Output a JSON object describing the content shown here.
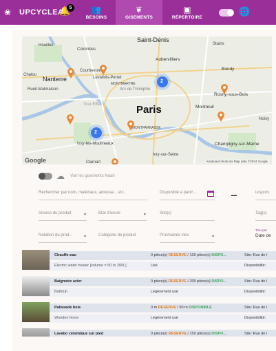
{
  "brand": {
    "name": "UPCYCLEA",
    "logo_icon": "upcyclea-logo-icon"
  },
  "notifications": {
    "count": "5",
    "icon": "bell-icon"
  },
  "nav": [
    {
      "label": "BESOINS",
      "icon": "needs-icon"
    },
    {
      "label": "GISEMENTS",
      "icon": "leaf-icon",
      "active": true
    },
    {
      "label": "RÉPERTOIRE",
      "icon": "directory-icon"
    }
  ],
  "header_right": {
    "toggle_icon": "theme-toggle",
    "globe_icon": "globe-icon"
  },
  "map": {
    "labels": {
      "houilles": "Houilles",
      "colombes": "Colombes",
      "saint_denis": "Saint-Denis",
      "stains": "Stains",
      "aubervilliers": "Aubervilliers",
      "chatou": "Chatou",
      "courbevoie": "Courbevoie",
      "levallois": "Levallois-Perret",
      "bondy": "Bondy",
      "nanterre": "Nanterre",
      "rueil": "Rueil-Malmaison",
      "montmartre": "MONTMARTRE",
      "arc": "Arc de Triomphe",
      "rosny": "Rosny-sous-Bois",
      "eiffel": "Tour Eiffel",
      "paris": "Paris",
      "montreuil": "Montreuil",
      "noisy": "Noisy",
      "montparnasse": "MONTPARNASSE",
      "issy": "Issy-les-Moulineaux",
      "champigny": "Champigny-sur-Marne",
      "ivry": "Ivry-sur-Seine",
      "clamart": "Clamart"
    },
    "clusters": [
      "2",
      "2"
    ],
    "attribution": "Keyboard shortcuts   Map data ©2024 Google",
    "google": "Google"
  },
  "noah": {
    "label": "Voir les gisements Noah"
  },
  "filters": {
    "search_placeholder": "Rechercher par nom, matériaux, adresse... etc..",
    "dispo_from": "Disponible à partir ...",
    "dispo_to": "Disponi",
    "source": "Source du produit",
    "usure": "Etat d'usure",
    "sites": "Site(s)",
    "tags": "Tag(s)",
    "notation": "Notation du prod...",
    "categorie": "Catégorie de produit",
    "vies": "Prochaines vies",
    "sort_label": "Trier par",
    "sort_value": "Date de"
  },
  "products": [
    {
      "title": "Chauffe-eau",
      "subtitle": "Electric water heater [volume = 50 to 200L]",
      "qty_a": "0 pièce(s) ",
      "reserve": "RESERVE",
      "qty_b": " / 100 pièce(s) ",
      "dispo": "DISPO...",
      "condition": "Usé",
      "site": "Site: Rue de l",
      "availability": "Disponibilité:"
    },
    {
      "title": "Baignoire acier",
      "subtitle": "Bathtub",
      "qty_a": "0 pièce(s) ",
      "reserve": "RESERVE",
      "qty_b": " / 200 pièce(s) ",
      "dispo": "DISPO...",
      "condition": "Légèrement usé",
      "site": "Site: Rue de l",
      "availability": "Disponibilité:"
    },
    {
      "title": "Palissade bois",
      "subtitle": "Wooden fence",
      "qty_a": "0 m ",
      "reserve": "RESERVE",
      "qty_b": " / 50 m ",
      "dispo": "DISPONIBLE",
      "condition": "Légèrement usé",
      "site": "Site: Rue de l",
      "availability": "Disponibilité:"
    },
    {
      "title": "Lavabo céramique sur pied",
      "subtitle": "",
      "qty_a": "0 pièce(s) ",
      "reserve": "RESERVE",
      "qty_b": " / 150 pièce(s) ",
      "dispo": "DISPO...",
      "condition": "",
      "site": "Site: Rue de l",
      "availability": ""
    }
  ]
}
